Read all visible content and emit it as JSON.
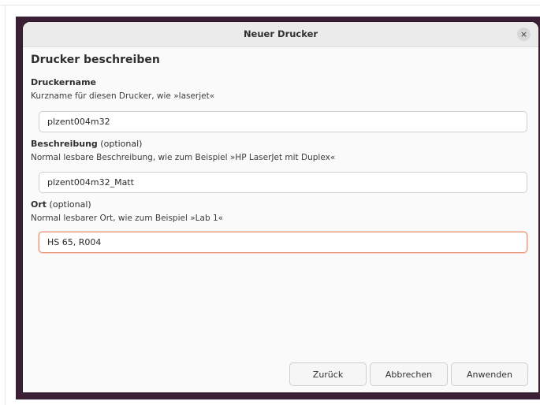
{
  "dialog": {
    "title": "Neuer Drucker",
    "close_glyph": "×",
    "close_icon": "close-icon"
  },
  "form": {
    "heading": "Drucker beschreiben",
    "name": {
      "label": "Druckername",
      "hint": "Kurzname für diesen Drucker, wie »laserjet«",
      "value": "plzent004m32"
    },
    "description": {
      "label": "Beschreibung",
      "optional": " (optional)",
      "hint": "Normal lesbare Beschreibung, wie zum Beispiel »HP LaserJet mit Duplex«",
      "value": "plzent004m32_Matt"
    },
    "location": {
      "label": "Ort",
      "optional": " (optional)",
      "hint": "Normal lesbarer Ort, wie zum Beispiel »Lab 1«",
      "value": "HS 65, R004"
    }
  },
  "buttons": {
    "back": "Zurück",
    "cancel": "Abbrechen",
    "apply": "Anwenden"
  },
  "colors": {
    "focus_accent": "#e95420",
    "wallpaper": "#3b1f35"
  }
}
